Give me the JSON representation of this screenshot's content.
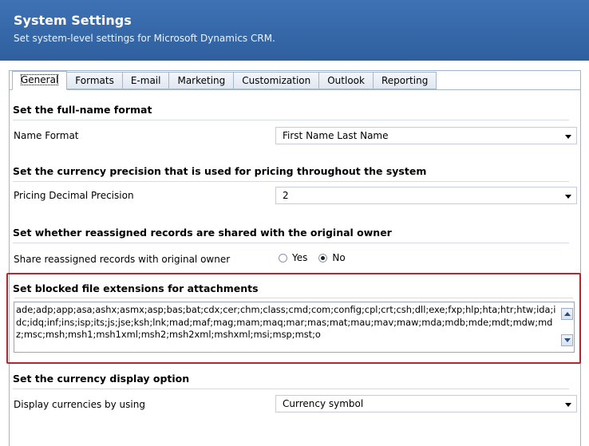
{
  "header": {
    "title": "System Settings",
    "subtitle": "Set system-level settings for Microsoft Dynamics CRM."
  },
  "tabs": [
    {
      "label": "General",
      "active": true
    },
    {
      "label": "Formats"
    },
    {
      "label": "E-mail"
    },
    {
      "label": "Marketing"
    },
    {
      "label": "Customization"
    },
    {
      "label": "Outlook"
    },
    {
      "label": "Reporting"
    }
  ],
  "sections": {
    "fullname": {
      "heading": "Set the full-name format",
      "label": "Name Format",
      "value": "First Name Last Name"
    },
    "currency_precision": {
      "heading": "Set the currency precision that is used for pricing throughout the system",
      "label": "Pricing Decimal Precision",
      "value": "2"
    },
    "reassigned": {
      "heading": "Set whether reassigned records are shared with the original owner",
      "label": "Share reassigned records with original owner",
      "option_yes": "Yes",
      "option_no": "No",
      "selected": "No"
    },
    "blocked": {
      "heading": "Set blocked file extensions for attachments",
      "value": "ade;adp;app;asa;ashx;asmx;asp;bas;bat;cdx;cer;chm;class;cmd;com;config;cpl;crt;csh;dll;exe;fxp;hlp;hta;htr;htw;ida;idc;idq;inf;ins;isp;its;js;jse;ksh;lnk;mad;maf;mag;mam;maq;mar;mas;mat;mau;mav;maw;mda;mdb;mde;mdt;mdw;mdz;msc;msh;msh1;msh1xml;msh2;msh2xml;mshxml;msi;msp;mst;o"
    },
    "currency_display": {
      "heading": "Set the currency display option",
      "label": "Display currencies by using",
      "value": "Currency symbol"
    }
  },
  "colors": {
    "header_bg": "#3466a8",
    "highlight_border": "#b3262b"
  }
}
